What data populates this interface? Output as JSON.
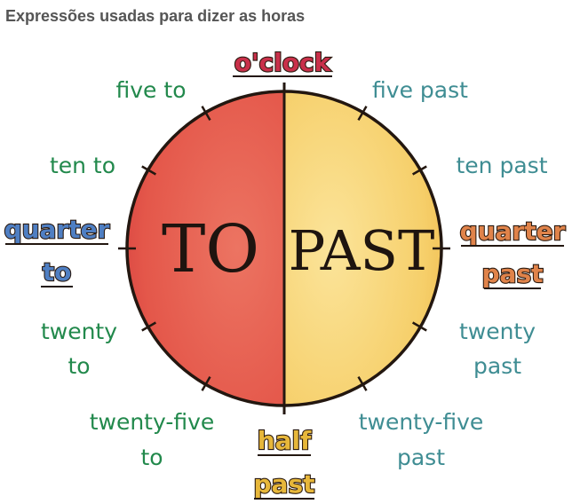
{
  "heading": "Expressões usadas para dizer as horas",
  "center": {
    "to": "TO",
    "past": "PAST"
  },
  "top": "o'clock",
  "bottom": {
    "line1": "half",
    "line2": "past"
  },
  "left_special": {
    "line1": "quarter",
    "line2": "to"
  },
  "right_special": {
    "line1": "quarter",
    "line2": "past"
  },
  "to_side": {
    "five": "five to",
    "ten": "ten to",
    "twenty_1": "twenty",
    "twenty_2": "to",
    "twentyfive_1": "twenty-five",
    "twentyfive_2": "to"
  },
  "past_side": {
    "five": "five past",
    "ten": "ten past",
    "twenty_1": "twenty",
    "twenty_2": "past",
    "twentyfive_1": "twenty-five",
    "twentyfive_2": "past"
  },
  "colors": {
    "to_fill": "#e4574a",
    "past_fill": "#f6cf6a",
    "to_text": "#22894c",
    "past_text": "#3f8d93",
    "oclock": "#c9304a",
    "half_past": "#e7b73a",
    "quarter_to": "#4f7fc3",
    "quarter_past": "#e0834a"
  }
}
